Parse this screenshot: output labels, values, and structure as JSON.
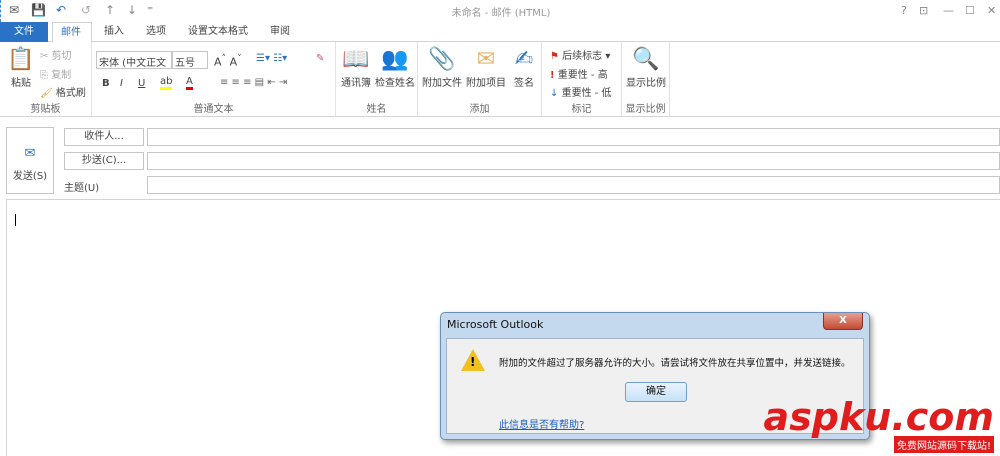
{
  "window": {
    "title": "未命名 - 邮件 (HTML)",
    "help": "?",
    "restore_ribbon": "⊡",
    "minimize": "—",
    "maximize": "☐",
    "close": "✕"
  },
  "quick_access": {
    "save": "💾",
    "undo": "↶",
    "redo": "↺",
    "up": "↑",
    "down": "↓",
    "more": "⁼"
  },
  "tabs": [
    "文件",
    "邮件",
    "插入",
    "选项",
    "设置文本格式",
    "审阅"
  ],
  "ribbon": {
    "clipboard": {
      "label": "剪贴板",
      "paste": "粘贴",
      "cut": "剪切",
      "copy": "复制",
      "format_painter": "格式刷"
    },
    "basic_text": {
      "label": "普通文本",
      "font": "宋体 (中文正文",
      "size": "五号",
      "bold": "B",
      "italic": "I",
      "underline": "U"
    },
    "names": {
      "label": "姓名",
      "address_book": "通讯簿",
      "check_names": "检查姓名"
    },
    "include": {
      "label": "添加",
      "attach_file": "附加文件",
      "attach_item": "附加项目",
      "signature": "签名"
    },
    "tags": {
      "label": "标记",
      "follow_up": "后续标志",
      "high": "重要性 - 高",
      "low": "重要性 - 低"
    },
    "zoom": {
      "label": "显示比例",
      "zoom": "显示比例"
    }
  },
  "compose": {
    "send": "发送(S)",
    "to": "收件人...",
    "cc": "抄送(C)...",
    "subject_label": "主题(U)",
    "to_value": "",
    "cc_value": "",
    "subject_value": ""
  },
  "dialog": {
    "title": "Microsoft Outlook",
    "close": "X",
    "message": "附加的文件超过了服务器允许的大小。请尝试将文件放在共享位置中，并发送链接。",
    "ok": "确定",
    "help_link": "此信息是否有帮助?"
  },
  "watermark": {
    "brand": "aspku.com",
    "tagline": "免费网站源码下载站!"
  }
}
